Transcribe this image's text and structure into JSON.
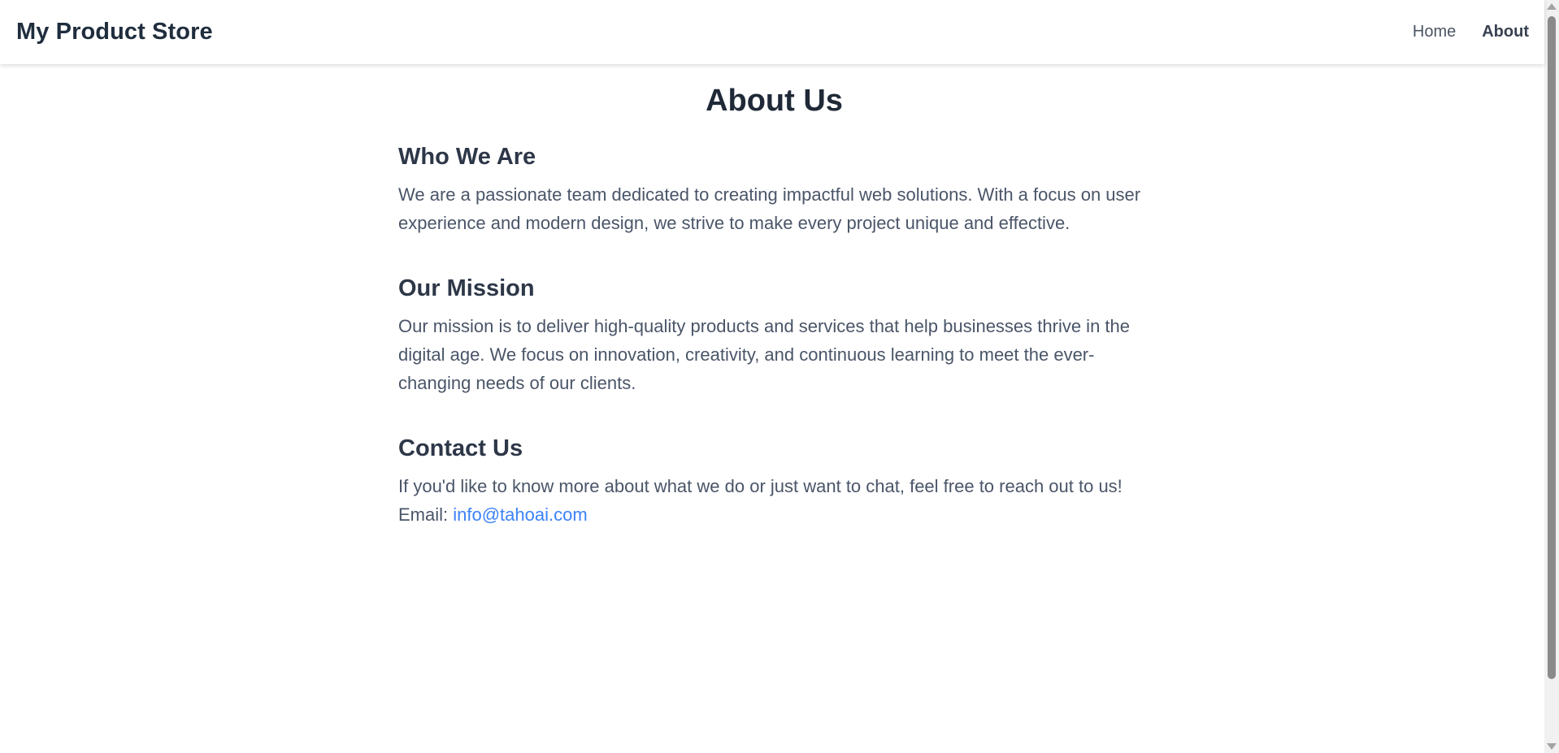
{
  "navbar": {
    "brand": "My Product Store",
    "links": [
      {
        "label": "Home",
        "active": false
      },
      {
        "label": "About",
        "active": true
      }
    ]
  },
  "main": {
    "title": "About Us",
    "sections": [
      {
        "heading": "Who We Are",
        "text": "We are a passionate team dedicated to creating impactful web solutions. With a focus on user experience and modern design, we strive to make every project unique and effective."
      },
      {
        "heading": "Our Mission",
        "text": "Our mission is to deliver high-quality products and services that help businesses thrive in the digital age. We focus on innovation, creativity, and continuous learning to meet the ever-changing needs of our clients."
      },
      {
        "heading": "Contact Us",
        "text": "If you'd like to know more about what we do or just want to chat, feel free to reach out to us!",
        "email_label": "Email:",
        "email": "info@tahoai.com"
      }
    ]
  },
  "colors": {
    "link": "#3b82f6",
    "heading": "#1f2937",
    "body_text": "#4a5568"
  }
}
